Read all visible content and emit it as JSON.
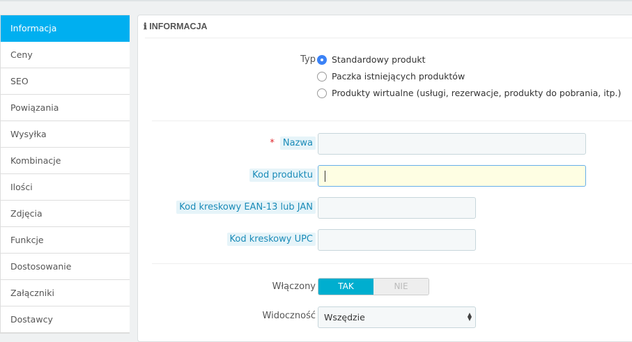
{
  "sidebar": {
    "items": [
      {
        "label": "Informacja"
      },
      {
        "label": "Ceny"
      },
      {
        "label": "SEO"
      },
      {
        "label": "Powiązania"
      },
      {
        "label": "Wysyłka"
      },
      {
        "label": "Kombinacje"
      },
      {
        "label": "Ilości"
      },
      {
        "label": "Zdjęcia"
      },
      {
        "label": "Funkcje"
      },
      {
        "label": "Dostosowanie"
      },
      {
        "label": "Załączniki"
      },
      {
        "label": "Dostawcy"
      }
    ]
  },
  "panel": {
    "title": "INFORMACJA",
    "type_label": "Typ",
    "type_options": [
      {
        "label": "Standardowy produkt",
        "selected": true
      },
      {
        "label": "Paczka istniejących produktów"
      },
      {
        "label": "Produkty wirtualne (usługi, rezerwacje, produkty do pobrania, itp.)"
      }
    ],
    "required_mark": "*",
    "name_label": "Nazwa",
    "name_value": "",
    "reference_label": "Kod produktu",
    "reference_value": "",
    "ean_label": "Kod kreskowy EAN-13 lub JAN",
    "ean_value": "",
    "upc_label": "Kod kreskowy UPC",
    "upc_value": "",
    "enabled_label": "Włączony",
    "enabled_yes": "TAK",
    "enabled_no": "NIE",
    "visibility_label": "Widoczność",
    "visibility_value": "Wszędzie"
  }
}
